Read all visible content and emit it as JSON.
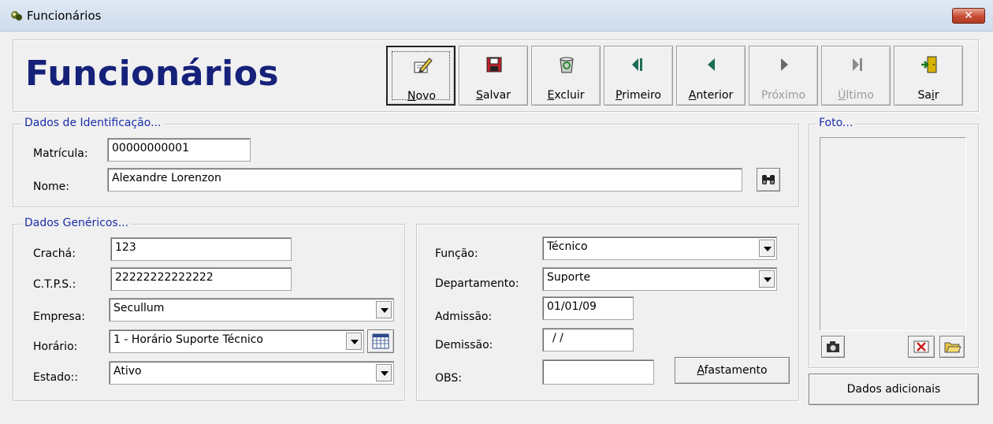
{
  "window": {
    "title": "Funcionários",
    "close_glyph": "✕"
  },
  "header": {
    "title": "Funcionários"
  },
  "toolbar": [
    {
      "id": "novo",
      "label": "Novo",
      "mnemonic": "N",
      "rest": "ovo",
      "icon": "pencil-paper-icon",
      "enabled": true
    },
    {
      "id": "salvar",
      "label": "Salvar",
      "mnemonic": "S",
      "rest": "alvar",
      "icon": "floppy-disk-icon",
      "enabled": true
    },
    {
      "id": "excluir",
      "label": "Excluir",
      "mnemonic": "E",
      "rest": "xcluir",
      "icon": "recycle-bin-icon",
      "enabled": true
    },
    {
      "id": "primeiro",
      "label": "Primeiro",
      "mnemonic": "P",
      "rest": "rimeiro",
      "icon": "first-record-icon",
      "enabled": true
    },
    {
      "id": "anterior",
      "label": "Anterior",
      "mnemonic": "A",
      "rest": "nterior",
      "icon": "previous-record-icon",
      "enabled": true
    },
    {
      "id": "proximo",
      "label": "Próximo",
      "mnemonic": "",
      "rest": "Próximo",
      "icon": "next-record-icon",
      "enabled": false
    },
    {
      "id": "ultimo",
      "label": "Último",
      "mnemonic": "Ú",
      "rest": "ltimo",
      "icon": "last-record-icon",
      "enabled": false
    },
    {
      "id": "sair",
      "label": "Sair",
      "pre": "Sa",
      "mnemonic": "i",
      "rest": "r",
      "icon": "exit-door-icon",
      "enabled": true
    }
  ],
  "identificacao": {
    "legend": "Dados de Identificação...",
    "matricula_label": "Matrícula:",
    "matricula_value": "00000000001",
    "nome_label": "Nome:",
    "nome_value": "Alexandre Lorenzon",
    "search_icon": "binoculars-icon"
  },
  "genericos": {
    "legend": "Dados Genéricos...",
    "cracha_label": "Crachá:",
    "cracha_value": "123",
    "ctps_label": "C.T.P.S.:",
    "ctps_value": "22222222222222",
    "empresa_label": "Empresa:",
    "empresa_value": "Secullum",
    "horario_label": "Horário:",
    "horario_value": "1 - Horário Suporte Técnico",
    "estado_label": "Estado::",
    "estado_value": "Ativo"
  },
  "funcao_panel": {
    "funcao_label": "Função:",
    "funcao_value": "Técnico",
    "departamento_label": "Departamento:",
    "departamento_value": "Suporte",
    "admissao_label": "Admissão:",
    "admissao_value": "01/01/09",
    "demissao_label": "Demissão:",
    "demissao_value": "/ /",
    "obs_label": "OBS:",
    "obs_value": "",
    "afastamento_mnemonic": "A",
    "afastamento_rest": "fastamento"
  },
  "foto": {
    "legend": "Foto...",
    "camera_icon": "camera-icon",
    "delete_icon": "delete-photo-icon",
    "open_icon": "open-folder-icon"
  },
  "dados_adicionais_label": "Dados adicionais"
}
